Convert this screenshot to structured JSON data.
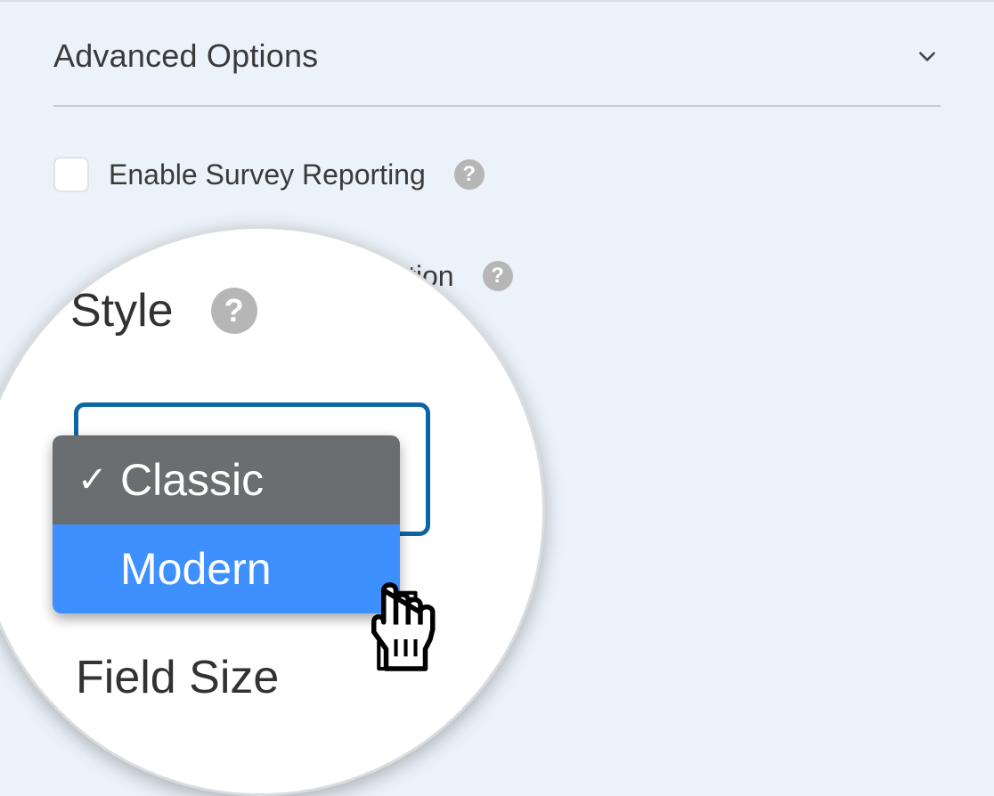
{
  "section": {
    "title": "Advanced Options",
    "expanded": true
  },
  "rows": {
    "survey": {
      "label": "Enable Survey Reporting",
      "checked": false
    },
    "secondary": {
      "partial_label": "ction",
      "checked": false
    }
  },
  "magnifier": {
    "style": {
      "label": "Style",
      "options": [
        "Classic",
        "Modern"
      ],
      "selected": "Classic",
      "hovered": "Modern"
    },
    "field_size": {
      "label": "Field Size"
    }
  }
}
